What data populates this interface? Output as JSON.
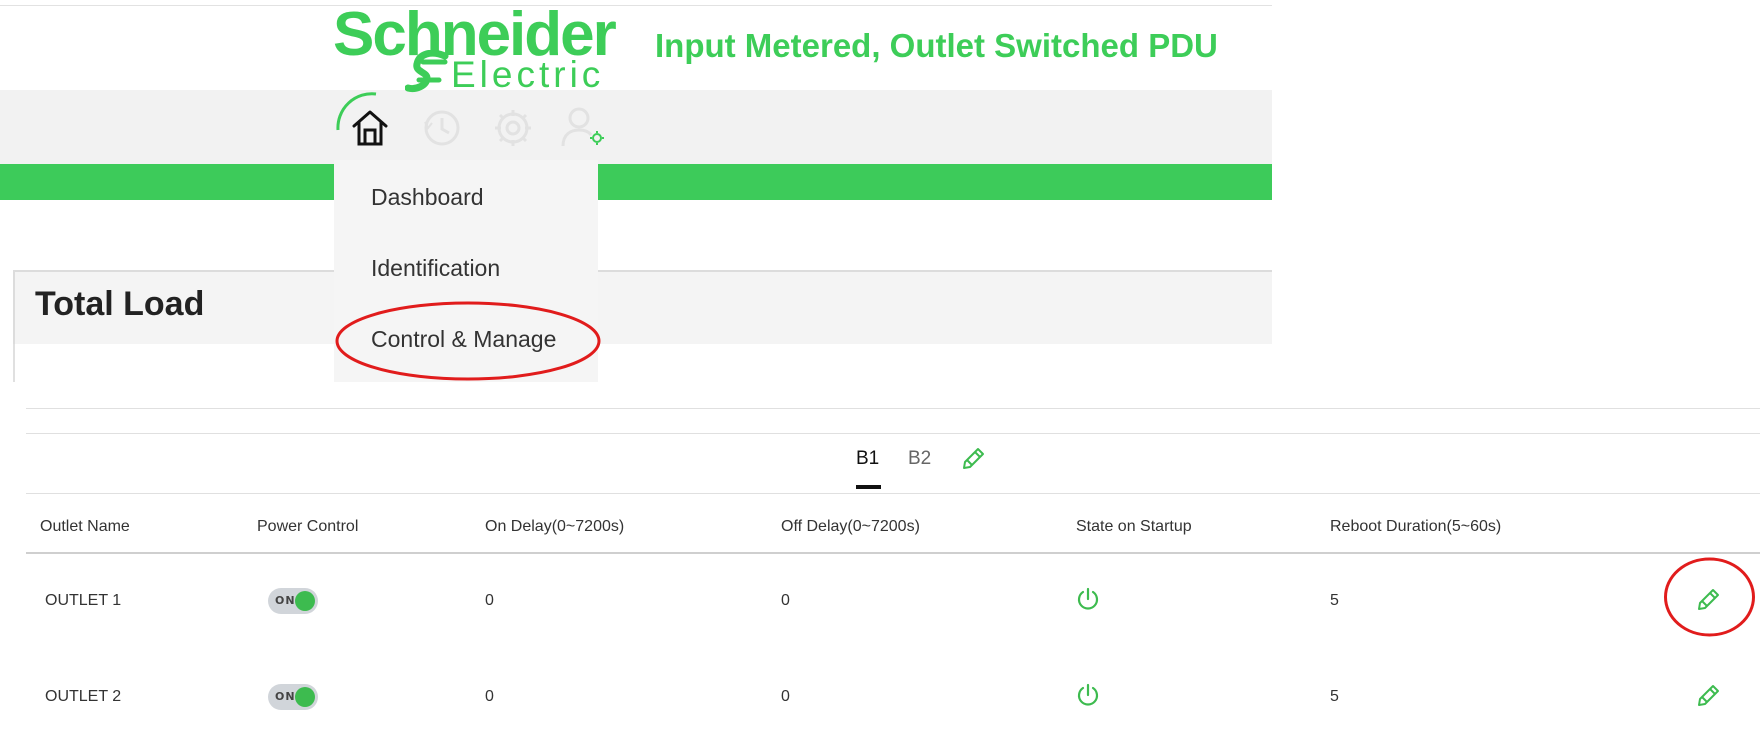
{
  "header": {
    "logo": {
      "line1": "Schneider",
      "line2": "Electric"
    },
    "product_title": "Input Metered, Outlet Switched PDU",
    "brand_color": "#3dcd58",
    "nav_icons": [
      "home-icon",
      "history-icon",
      "settings-icon",
      "user-settings-icon"
    ],
    "menu": {
      "items": [
        {
          "label": "Dashboard"
        },
        {
          "label": "Identification"
        },
        {
          "label": "Control & Manage",
          "highlighted": true
        }
      ]
    }
  },
  "total_load": {
    "title": "Total Load"
  },
  "outlets": {
    "tabs": [
      {
        "label": "B1",
        "active": true
      },
      {
        "label": "B2",
        "active": false
      }
    ],
    "columns": [
      "Outlet Name",
      "Power Control",
      "On Delay(0~7200s)",
      "Off Delay(0~7200s)",
      "State on Startup",
      "Reboot Duration(5~60s)"
    ],
    "rows": [
      {
        "name": "OUTLET 1",
        "power": "ON",
        "on_delay": "0",
        "off_delay": "0",
        "state_on_startup": "power-icon",
        "reboot_duration": "5",
        "edit_highlighted": true
      },
      {
        "name": "OUTLET 2",
        "power": "ON",
        "on_delay": "0",
        "off_delay": "0",
        "state_on_startup": "power-icon",
        "reboot_duration": "5",
        "edit_highlighted": false
      }
    ]
  },
  "annotation_color": "#e11c1c"
}
